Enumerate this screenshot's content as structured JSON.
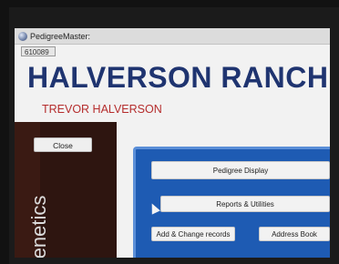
{
  "window": {
    "title": "PedigreeMaster:",
    "record_id": "610089"
  },
  "header": {
    "ranch_name": "HALVERSON RANCH",
    "owner": "TREVOR HALVERSON"
  },
  "sidebar": {
    "close_label": "Close",
    "section_label": "Genetics"
  },
  "menu": {
    "pedigree_display": "Pedigree Display",
    "reports_utilities": "Reports & Utilities",
    "add_change_records": "Add & Change records",
    "address_book": "Address Book"
  },
  "colors": {
    "title": "#1f3470",
    "owner": "#b52d2d",
    "panel": "#1e5bb3",
    "sidebar": "#2e1510"
  },
  "icons": {
    "app": "pedigreemaster-app-icon",
    "pointer": "mouse-pointer-icon"
  }
}
